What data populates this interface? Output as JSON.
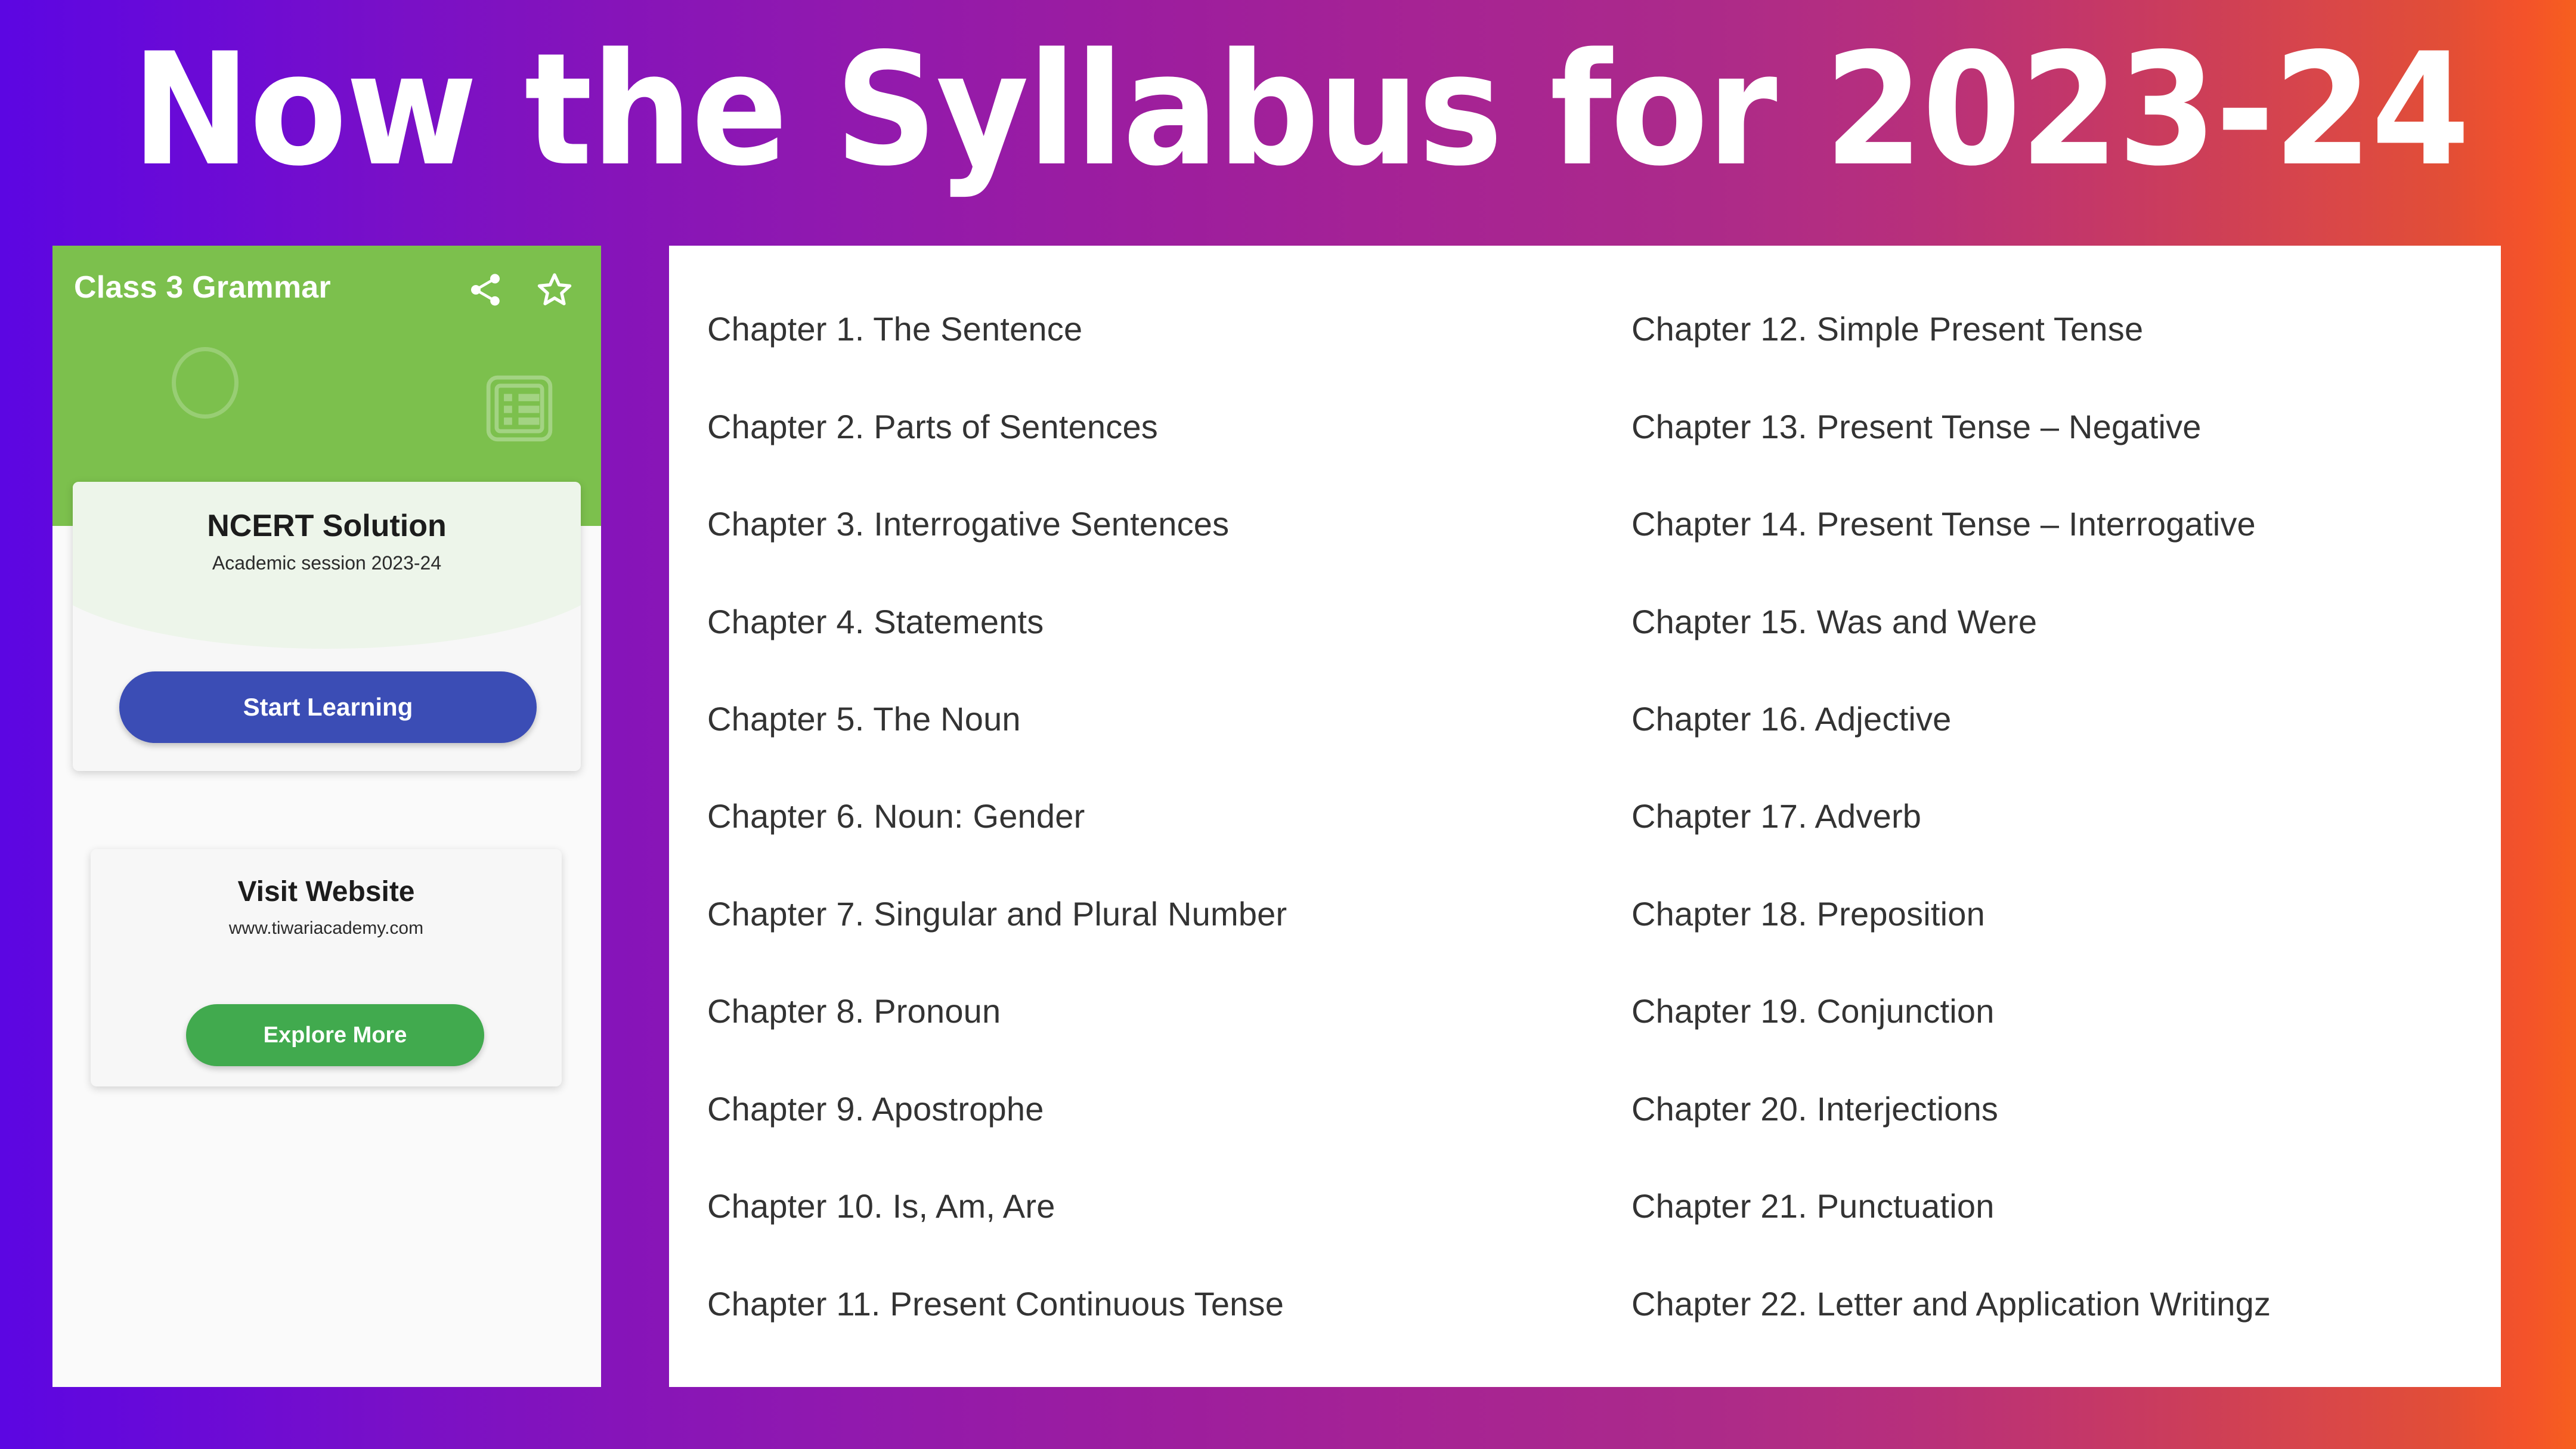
{
  "headline": "Now the Syllabus for 2023-24",
  "background": {
    "gradient_start": "#5C06E2",
    "gradient_mid": "#9119AE",
    "gradient_end": "#F65F1E"
  },
  "app_preview": {
    "header": {
      "title": "Class 3 Grammar",
      "background_color": "#7CC04D",
      "icons": [
        "share-icon",
        "star-outline-icon",
        "circle-outline-decoration",
        "list-article-watermark"
      ]
    },
    "ncert_card": {
      "title": "NCERT Solution",
      "subtitle": "Academic session 2023-24",
      "button_label": "Start Learning",
      "button_color": "#3B4DB5"
    },
    "website_card": {
      "title": "Visit Website",
      "url": "www.tiwariacademy.com",
      "button_label": "Explore More",
      "button_color": "#41AA4E"
    }
  },
  "chapters": {
    "left_column": [
      "Chapter 1. The Sentence",
      "Chapter 2. Parts of Sentences",
      "Chapter 3. Interrogative Sentences",
      "Chapter 4. Statements",
      "Chapter 5. The Noun",
      "Chapter 6. Noun: Gender",
      "Chapter 7. Singular and Plural Number",
      "Chapter 8. Pronoun",
      "Chapter 9. Apostrophe",
      "Chapter 10. Is, Am, Are",
      "Chapter 11. Present Continuous Tense"
    ],
    "right_column": [
      "Chapter 12. Simple Present Tense",
      "Chapter 13. Present Tense – Negative",
      "Chapter 14. Present Tense – Interrogative",
      "Chapter 15. Was and Were",
      "Chapter 16. Adjective",
      "Chapter 17. Adverb",
      "Chapter 18. Preposition",
      "Chapter 19. Conjunction",
      "Chapter 20. Interjections",
      "Chapter 21. Punctuation",
      "Chapter 22. Letter and Application Writingz"
    ]
  }
}
